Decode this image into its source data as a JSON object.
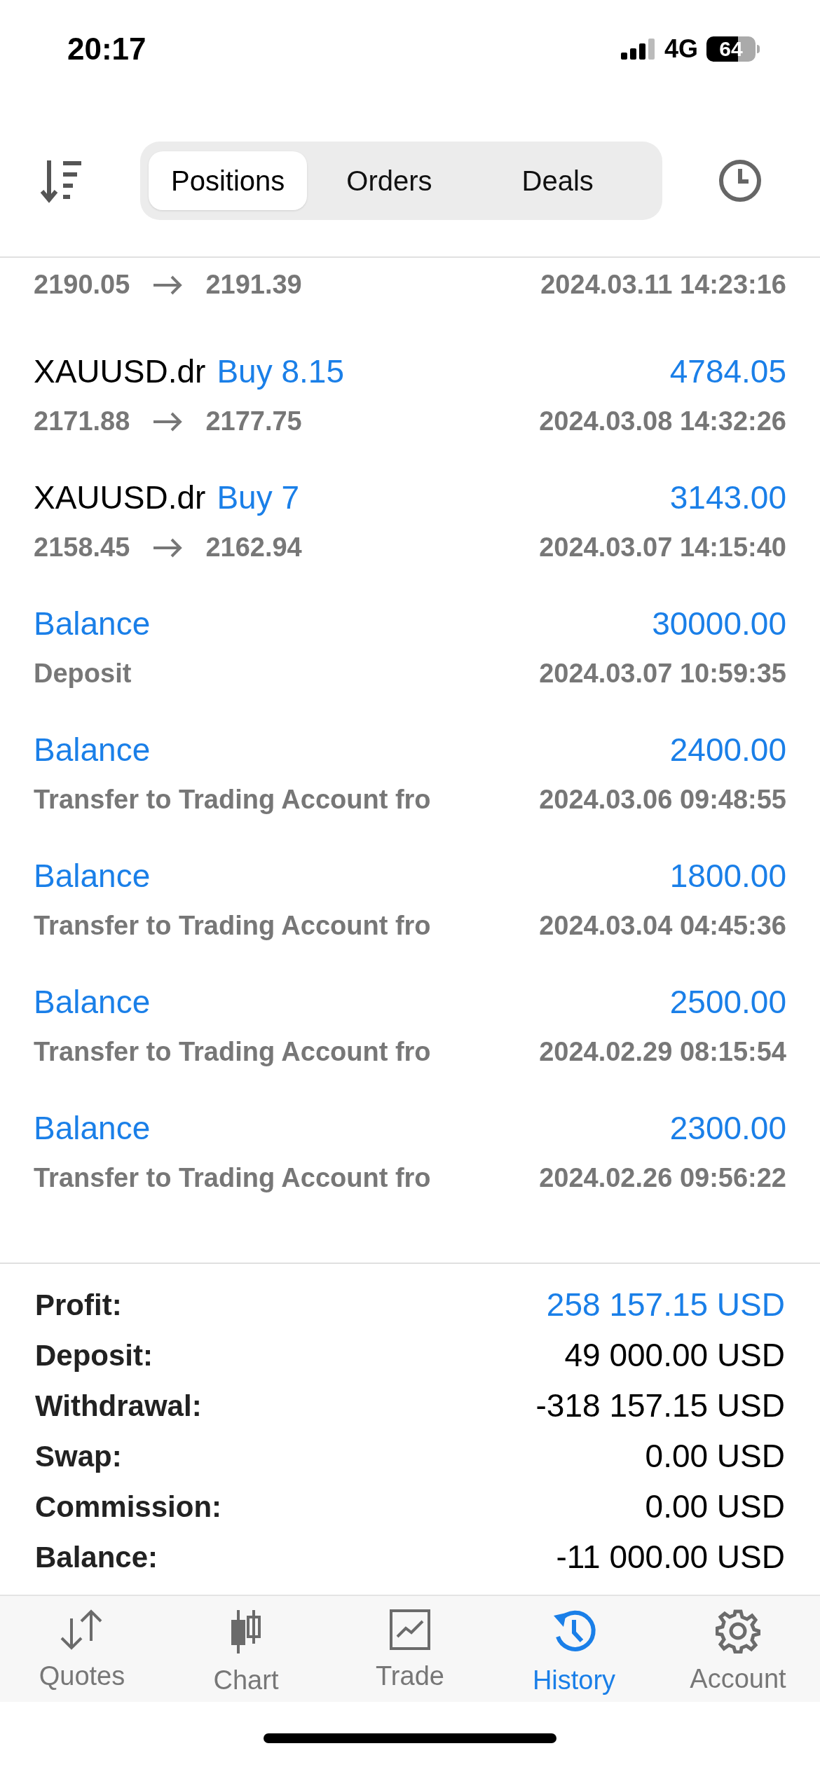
{
  "status_bar": {
    "time": "20:17",
    "network": "4G",
    "battery": "64"
  },
  "tabs": [
    {
      "label": "Positions",
      "selected": true
    },
    {
      "label": "Orders",
      "selected": false
    },
    {
      "label": "Deals",
      "selected": false
    }
  ],
  "rows": [
    {
      "kind": "trade",
      "open_price": "2190.05",
      "close_price": "2191.39",
      "time": "2024.03.11 14:23:16"
    },
    {
      "kind": "trade",
      "symbol": "XAUUSD.dr",
      "side": "Buy 8.15",
      "amount": "4784.05",
      "open_price": "2171.88",
      "close_price": "2177.75",
      "time": "2024.03.08 14:32:26"
    },
    {
      "kind": "trade",
      "symbol": "XAUUSD.dr",
      "side": "Buy 7",
      "amount": "3143.00",
      "open_price": "2158.45",
      "close_price": "2162.94",
      "time": "2024.03.07 14:15:40"
    },
    {
      "kind": "balance",
      "title": "Balance",
      "amount": "30000.00",
      "comment": "Deposit",
      "time": "2024.03.07 10:59:35"
    },
    {
      "kind": "balance",
      "title": "Balance",
      "amount": "2400.00",
      "comment": "Transfer to Trading Account fro",
      "time": "2024.03.06 09:48:55"
    },
    {
      "kind": "balance",
      "title": "Balance",
      "amount": "1800.00",
      "comment": "Transfer to Trading Account fro",
      "time": "2024.03.04 04:45:36"
    },
    {
      "kind": "balance",
      "title": "Balance",
      "amount": "2500.00",
      "comment": "Transfer to Trading Account fro",
      "time": "2024.02.29 08:15:54"
    },
    {
      "kind": "balance",
      "title": "Balance",
      "amount": "2300.00",
      "comment": "Transfer to Trading Account fro",
      "time": "2024.02.26 09:56:22"
    }
  ],
  "summary": [
    {
      "label": "Profit:",
      "value": "258 157.15 USD",
      "color": "#1a7fe8"
    },
    {
      "label": "Deposit:",
      "value": "49 000.00 USD",
      "color": "#000000"
    },
    {
      "label": "Withdrawal:",
      "value": "-318 157.15 USD",
      "color": "#000000"
    },
    {
      "label": "Swap:",
      "value": "0.00 USD",
      "color": "#000000"
    },
    {
      "label": "Commission:",
      "value": "0.00 USD",
      "color": "#000000"
    },
    {
      "label": "Balance:",
      "value": "-11 000.00 USD",
      "color": "#000000"
    }
  ],
  "nav": [
    {
      "label": "Quotes",
      "selected": false
    },
    {
      "label": "Chart",
      "selected": false
    },
    {
      "label": "Trade",
      "selected": false
    },
    {
      "label": "History",
      "selected": true
    },
    {
      "label": "Account",
      "selected": false
    }
  ]
}
